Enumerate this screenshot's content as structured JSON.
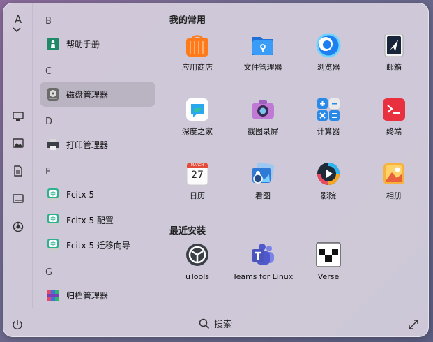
{
  "sidebar": {
    "sort_letter": "A",
    "categories": [
      "computer-icon",
      "image-icon",
      "document-icon",
      "monitor-icon",
      "sports-ball-icon"
    ]
  },
  "app_list": {
    "groups": [
      {
        "letter": "B",
        "items": [
          {
            "label": "帮助手册",
            "icon": "lighthouse-icon"
          }
        ]
      },
      {
        "letter": "C",
        "items": [
          {
            "label": "磁盘管理器",
            "icon": "disk-icon",
            "selected": true
          }
        ]
      },
      {
        "letter": "D",
        "items": [
          {
            "label": "打印管理器",
            "icon": "printer-icon"
          }
        ]
      },
      {
        "letter": "F",
        "items": [
          {
            "label": "Fcitx 5",
            "icon": "keyboard-icon"
          },
          {
            "label": "Fcitx 5 配置",
            "icon": "keyboard-icon"
          },
          {
            "label": "Fcitx 5 迁移向导",
            "icon": "keyboard-icon"
          }
        ]
      },
      {
        "letter": "G",
        "items": [
          {
            "label": "归档管理器",
            "icon": "archive-icon"
          }
        ]
      }
    ]
  },
  "favorites": {
    "title": "我的常用",
    "apps": [
      {
        "label": "应用商店",
        "icon": "store-icon"
      },
      {
        "label": "文件管理器",
        "icon": "file-manager-icon"
      },
      {
        "label": "浏览器",
        "icon": "browser-icon"
      },
      {
        "label": "邮箱",
        "icon": "mail-icon"
      },
      {
        "label": "深度之家",
        "icon": "deepin-home-icon"
      },
      {
        "label": "截图录屏",
        "icon": "camera-icon"
      },
      {
        "label": "计算器",
        "icon": "calculator-icon"
      },
      {
        "label": "终端",
        "icon": "terminal-icon"
      },
      {
        "label": "日历",
        "icon": "calendar-icon",
        "calendar_month": "MARCH",
        "calendar_day": "27"
      },
      {
        "label": "看图",
        "icon": "image-viewer-icon"
      },
      {
        "label": "影院",
        "icon": "movie-icon"
      },
      {
        "label": "相册",
        "icon": "photos-icon"
      }
    ]
  },
  "recent": {
    "title": "最近安装",
    "apps": [
      {
        "label": "uTools",
        "icon": "utools-icon"
      },
      {
        "label": "Teams for Linux",
        "icon": "teams-icon"
      },
      {
        "label": "Verse",
        "icon": "verse-icon"
      }
    ]
  },
  "bottom_bar": {
    "search_label": "搜索"
  }
}
